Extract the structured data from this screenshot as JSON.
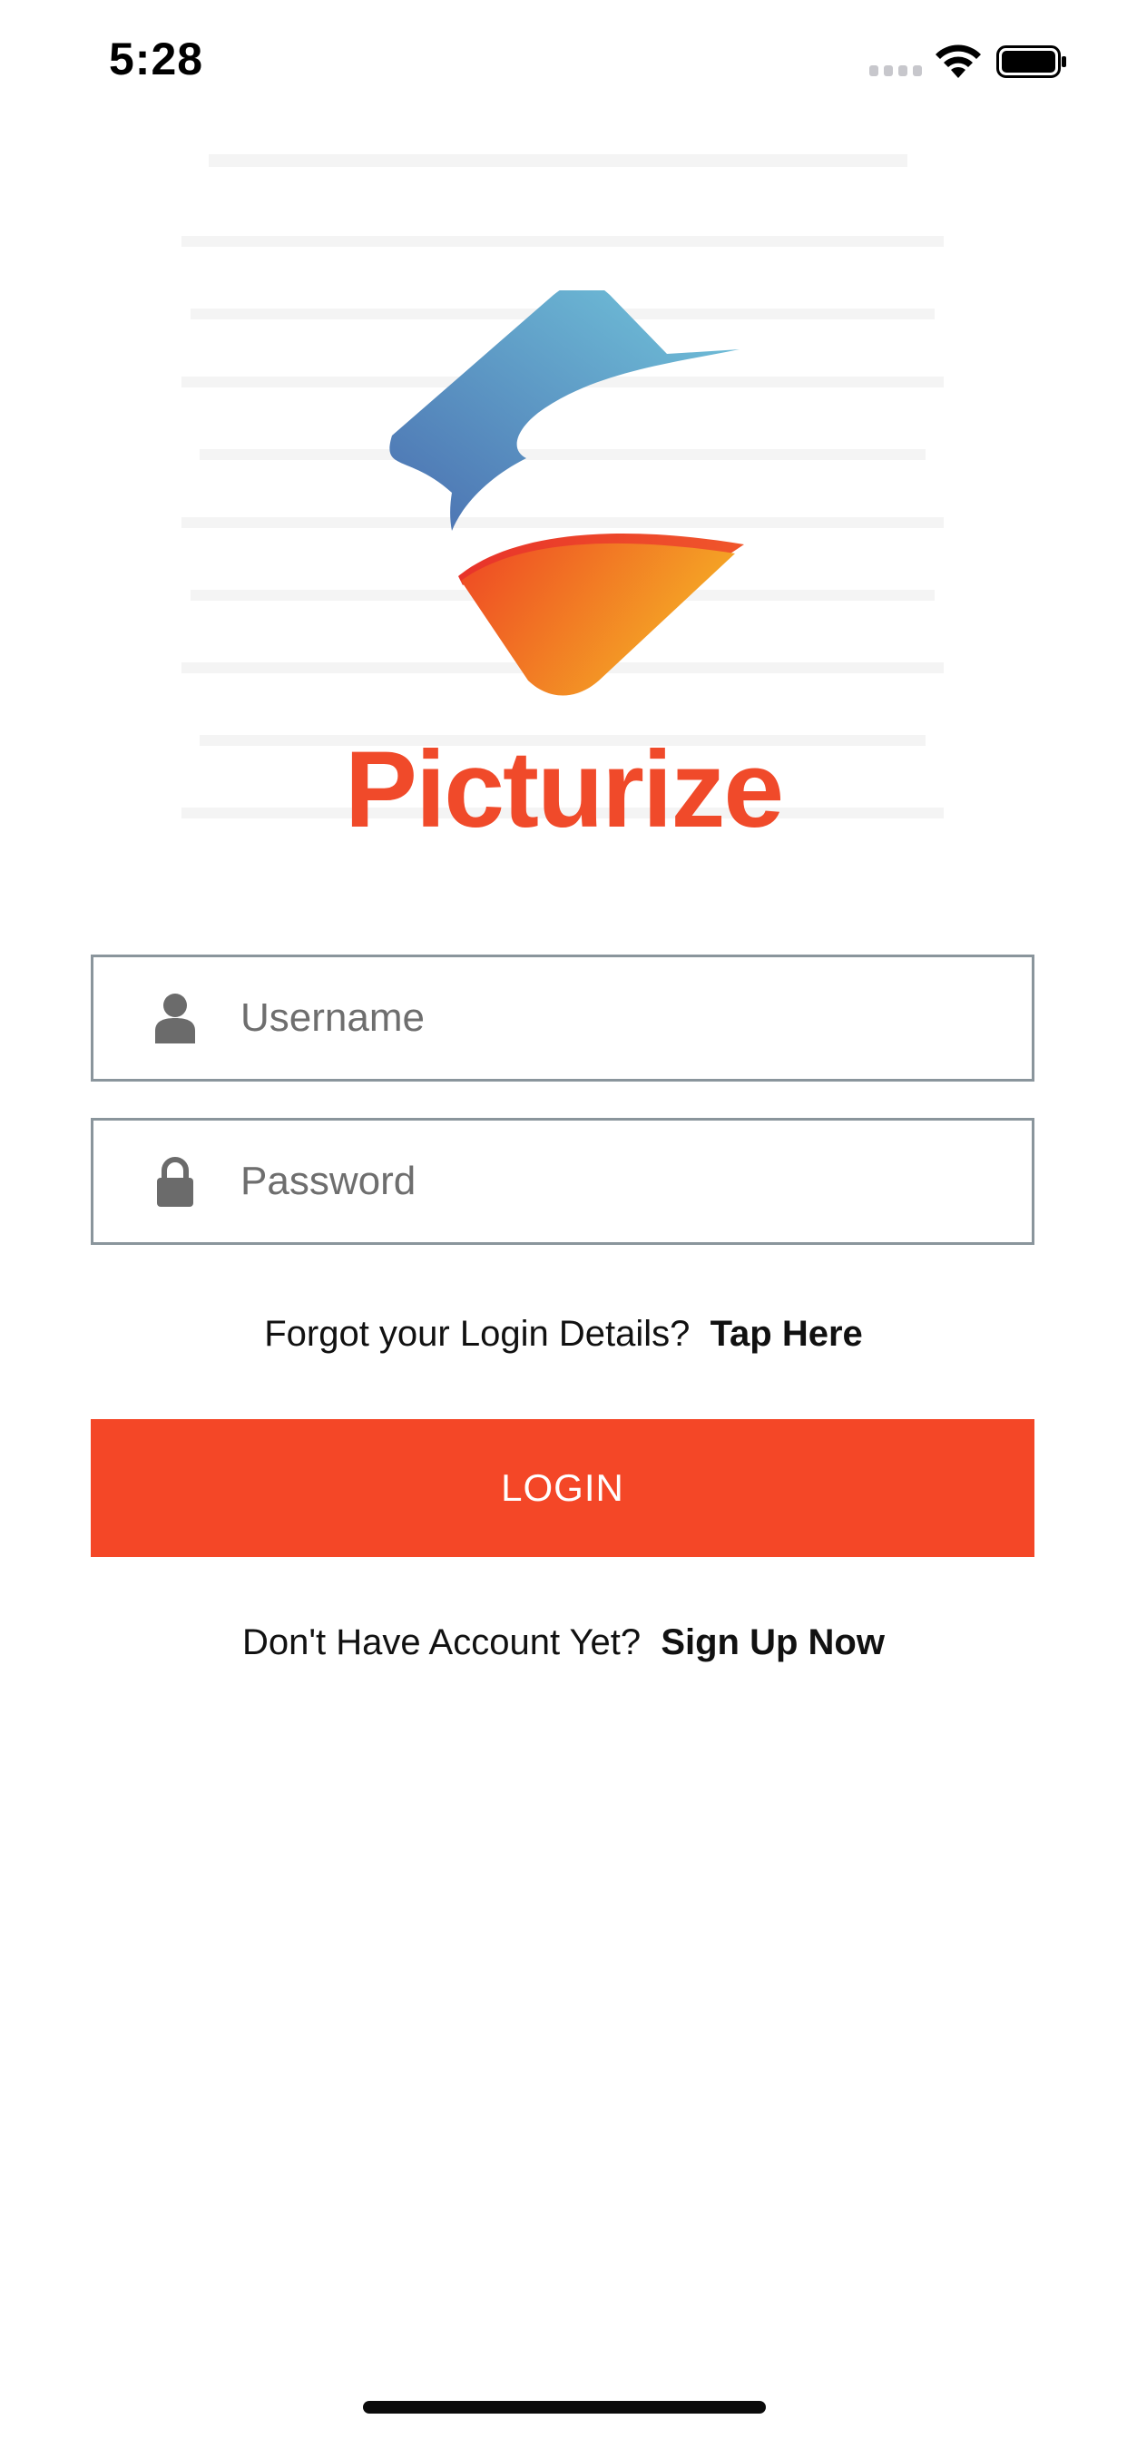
{
  "status_bar": {
    "time": "5:28",
    "icons": [
      "cellular-signal-icon",
      "wifi-icon",
      "battery-icon"
    ]
  },
  "brand": {
    "name": "Picturize",
    "logo_icon": "picturize-logo-icon",
    "wordmark_color": "#f04a2a"
  },
  "form": {
    "username": {
      "placeholder": "Username",
      "value": "",
      "icon": "user-icon"
    },
    "password": {
      "placeholder": "Password",
      "value": "",
      "icon": "lock-icon"
    }
  },
  "forgot": {
    "prompt": "Forgot your Login Details?",
    "link_label": "Tap Here"
  },
  "login_button": {
    "label": "LOGIN",
    "color": "#f44727"
  },
  "signup": {
    "prompt": "Don't Have Account Yet?",
    "link_label": "Sign Up Now"
  },
  "colors": {
    "accent": "#f44727",
    "field_border": "#8a959c",
    "icon_gray": "#6b6b6b",
    "logo_blue_start": "#4a6fb0",
    "logo_blue_end": "#6ec3d9",
    "logo_orange_start": "#ee4624",
    "logo_orange_end": "#f5a623"
  }
}
